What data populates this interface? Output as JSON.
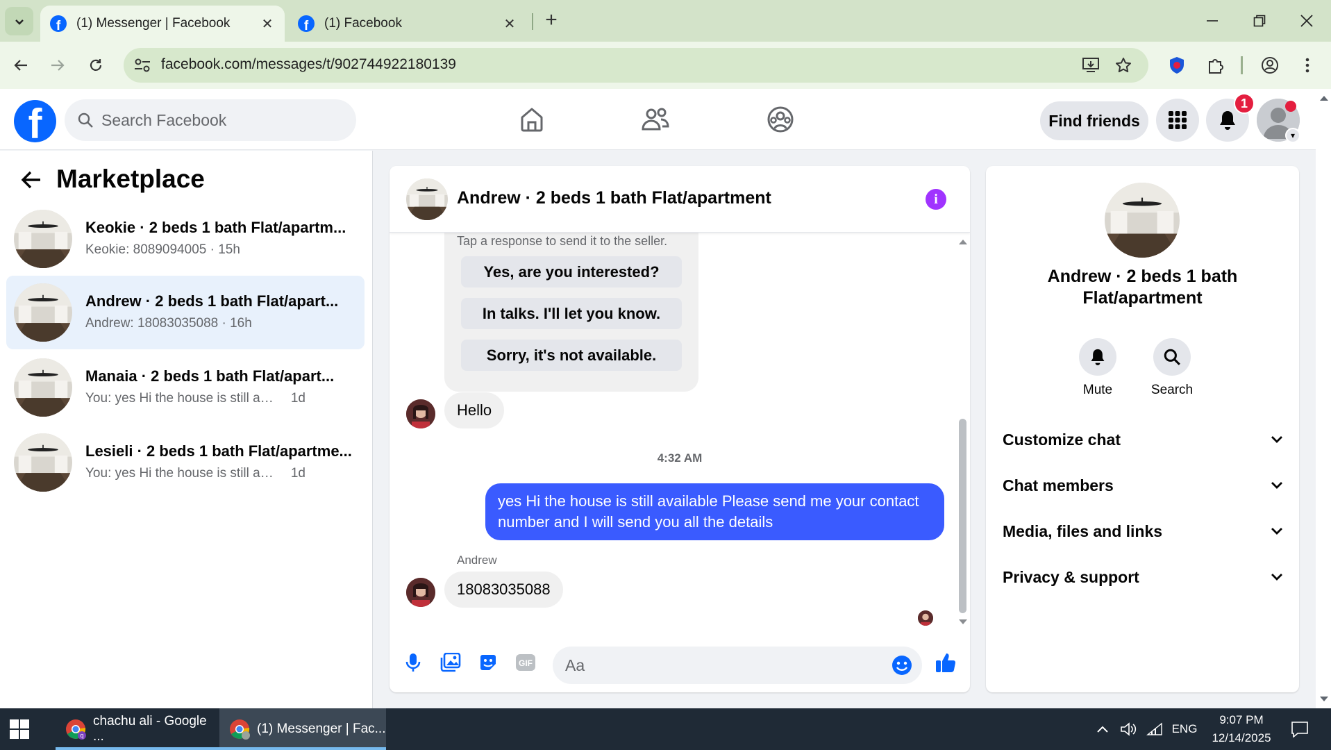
{
  "browser": {
    "tabs": [
      {
        "title": "(1) Messenger | Facebook",
        "active": true
      },
      {
        "title": "(1) Facebook",
        "active": false
      }
    ],
    "url": "facebook.com/messages/t/902744922180139"
  },
  "fb_header": {
    "search_placeholder": "Search Facebook",
    "find_friends": "Find friends",
    "notification_count": "1",
    "icons": [
      "home-icon",
      "friends-icon",
      "groups-icon",
      "menu-grid-icon",
      "bell-icon"
    ]
  },
  "sidebar": {
    "title": "Marketplace",
    "conversations": [
      {
        "name": "Keokie · 2 beds 1 bath Flat/apartm...",
        "preview": "Keokie: 8089094005",
        "time": "15h",
        "selected": false
      },
      {
        "name": "Andrew · 2 beds 1 bath Flat/apart...",
        "preview": "Andrew: 18083035088",
        "time": "16h",
        "selected": true
      },
      {
        "name": "Manaia · 2 beds 1 bath Flat/apart...",
        "preview": "You: yes Hi the house is still available ...",
        "time": "1d",
        "selected": false
      },
      {
        "name": "Lesieli · 2 beds 1 bath Flat/apartme...",
        "preview": "You: yes Hi the house is still available ...",
        "time": "1d",
        "selected": false
      }
    ]
  },
  "chat": {
    "title": "Andrew · 2 beds 1 bath Flat/apartment",
    "quick_reply_hint": "Tap a response to send it to the seller.",
    "quick_replies": [
      "Yes, are you interested?",
      "In talks. I'll let you know.",
      "Sorry, it's not available."
    ],
    "msg_hello": "Hello",
    "timestamp": "4:32 AM",
    "msg_outgoing": "yes Hi the house is still available Please send me your contact number and I will send you all the details",
    "sender_label": "Andrew",
    "msg_number": "18083035088",
    "input_placeholder": "Aa"
  },
  "right_panel": {
    "name": "Andrew · 2 beds 1 bath Flat/apartment",
    "actions": [
      {
        "label": "Mute",
        "icon": "bell-icon"
      },
      {
        "label": "Search",
        "icon": "search-icon"
      }
    ],
    "sections": [
      "Customize chat",
      "Chat members",
      "Media, files and links",
      "Privacy & support"
    ]
  },
  "taskbar": {
    "items": [
      {
        "label": "chachu ali - Google ...",
        "active": false
      },
      {
        "label": "(1) Messenger | Fac...",
        "active": true
      }
    ],
    "language": "ENG",
    "time": "9:07 PM",
    "date": "12/14/2025"
  },
  "colors": {
    "fb_blue": "#0866ff",
    "outgoing_bubble": "#3a5bff",
    "selected_conv": "#e8f1fc",
    "info_purple": "#a033ff",
    "badge_red": "#e41e3f"
  }
}
